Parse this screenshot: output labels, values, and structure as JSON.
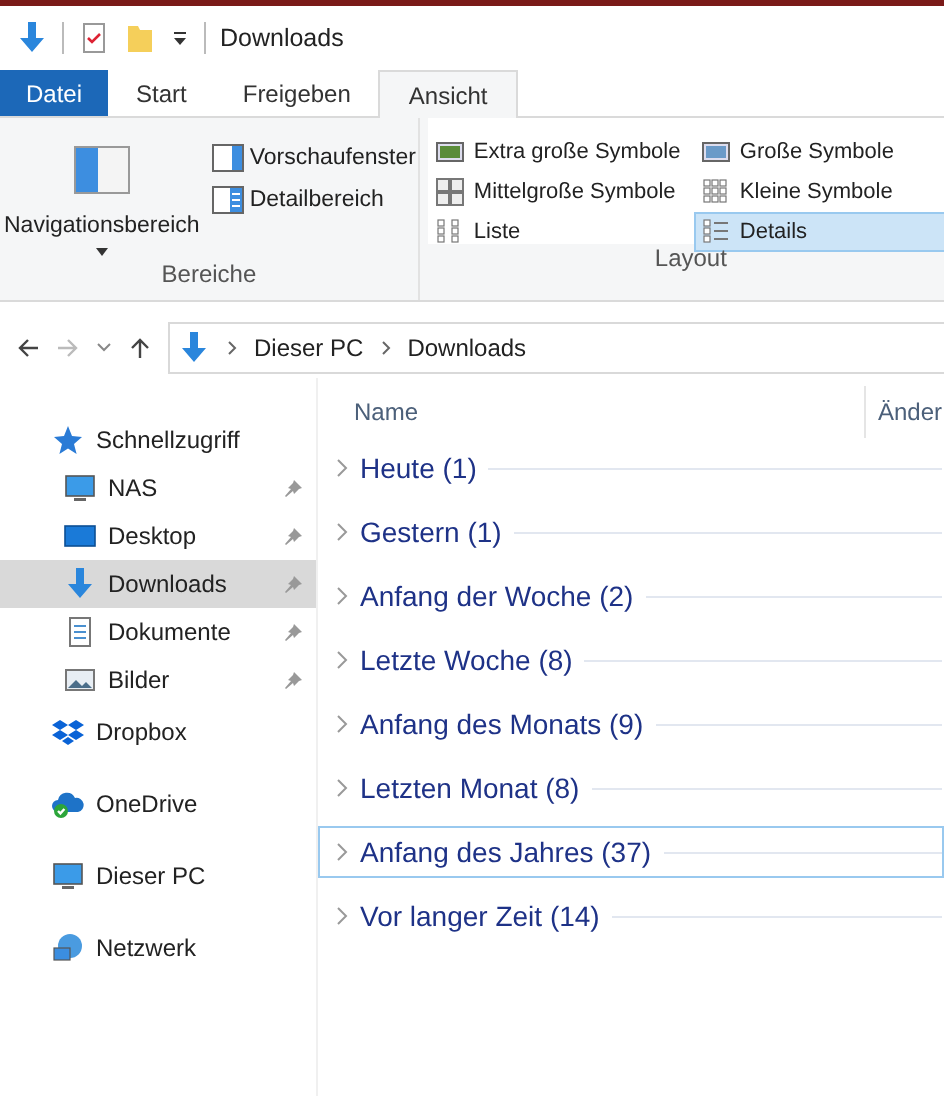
{
  "window": {
    "title": "Downloads"
  },
  "tabs": [
    {
      "label": "Datei",
      "kind": "file",
      "selected": false
    },
    {
      "label": "Start",
      "kind": "tab",
      "selected": false
    },
    {
      "label": "Freigeben",
      "kind": "tab",
      "selected": false
    },
    {
      "label": "Ansicht",
      "kind": "tab",
      "selected": true
    }
  ],
  "ribbon": {
    "panes": {
      "title": "Bereiche",
      "navigation": "Navigationsbereich",
      "preview": "Vorschaufenster",
      "details": "Detailbereich"
    },
    "layout": {
      "title": "Layout",
      "options": [
        {
          "label": "Extra große Symbole",
          "kind": "extra",
          "selected": false
        },
        {
          "label": "Große Symbole",
          "kind": "large",
          "selected": false
        },
        {
          "label": "Mittelgroße Symbole",
          "kind": "medium",
          "selected": false
        },
        {
          "label": "Kleine Symbole",
          "kind": "small",
          "selected": false
        },
        {
          "label": "Liste",
          "kind": "list",
          "selected": false
        },
        {
          "label": "Details",
          "kind": "details",
          "selected": true
        }
      ]
    }
  },
  "address": {
    "path": [
      "Dieser PC",
      "Downloads"
    ]
  },
  "sidebar": {
    "items": [
      {
        "label": "Schnellzugriff",
        "kind": "star",
        "children": [
          {
            "label": "NAS",
            "kind": "monitor",
            "pinned": true,
            "selected": false
          },
          {
            "label": "Desktop",
            "kind": "desktop",
            "pinned": true,
            "selected": false
          },
          {
            "label": "Downloads",
            "kind": "download",
            "pinned": true,
            "selected": true
          },
          {
            "label": "Dokumente",
            "kind": "document",
            "pinned": true,
            "selected": false
          },
          {
            "label": "Bilder",
            "kind": "pictures",
            "pinned": true,
            "selected": false
          }
        ]
      },
      {
        "label": "Dropbox",
        "kind": "dropbox"
      },
      {
        "label": "OneDrive",
        "kind": "cloud"
      },
      {
        "label": "Dieser PC",
        "kind": "monitor"
      },
      {
        "label": "Netzwerk",
        "kind": "network"
      }
    ]
  },
  "table": {
    "columns": [
      "Name",
      "Änder"
    ],
    "groups": [
      {
        "label": "Heute (1)",
        "focused": false
      },
      {
        "label": "Gestern (1)",
        "focused": false
      },
      {
        "label": "Anfang der Woche (2)",
        "focused": false
      },
      {
        "label": "Letzte Woche (8)",
        "focused": false
      },
      {
        "label": "Anfang des Monats (9)",
        "focused": false
      },
      {
        "label": "Letzten Monat (8)",
        "focused": false
      },
      {
        "label": "Anfang des Jahres (37)",
        "focused": true
      },
      {
        "label": "Vor langer Zeit (14)",
        "focused": false
      }
    ]
  }
}
